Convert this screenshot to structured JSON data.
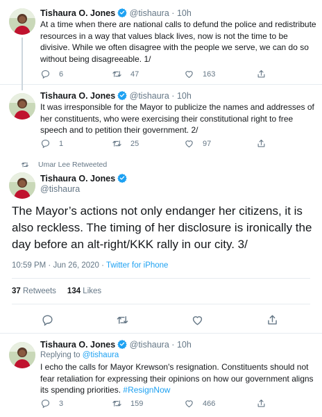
{
  "user": {
    "name": "Tishaura O. Jones",
    "handle": "@tishaura",
    "verified_color": "#1da1f2"
  },
  "tweets": [
    {
      "time": "10h",
      "text": "At a time when there are national calls to defund the police and redistribute resources in a way that values black lives, now is not the time to be divisive. While we often disagree with the people we serve, we can do so without being disagreeable. 1/",
      "replies": "6",
      "retweets": "47",
      "likes": "163"
    },
    {
      "time": "10h",
      "text": "It was irresponsible for the Mayor to publicize the names and addresses of her constituents, who were exercising their constitutional right to free speech and to petition their government. 2/",
      "replies": "1",
      "retweets": "25",
      "likes": "97"
    }
  ],
  "main_tweet": {
    "retweeted_by": "Umar Lee Retweeted",
    "text": "The Mayor’s actions not only endanger her citizens, it is also reckless. The timing of her disclosure is ironically the day before an alt-right/KKK rally in our city. 3/",
    "timestamp": "10:59 PM · Jun 26, 2020 · ",
    "source": "Twitter for iPhone",
    "retweets_count": "37",
    "retweets_label": " Retweets",
    "likes_count": "134",
    "likes_label": " Likes"
  },
  "reply_tweet": {
    "time": "10h",
    "replying_prefix": "Replying to ",
    "replying_handle": "@tishaura",
    "text": "I echo the calls for Mayor Krewson's resignation. Constituents should not fear retaliation for expressing their opinions on how our government aligns its spending priorities. ",
    "hashtag": "#ResignNow",
    "replies": "3",
    "retweets": "159",
    "likes": "466"
  },
  "sep": "·",
  "colors": {
    "accent": "#1da1f2",
    "muted": "#657786",
    "text": "#14171a",
    "border": "#e6ecf0"
  }
}
